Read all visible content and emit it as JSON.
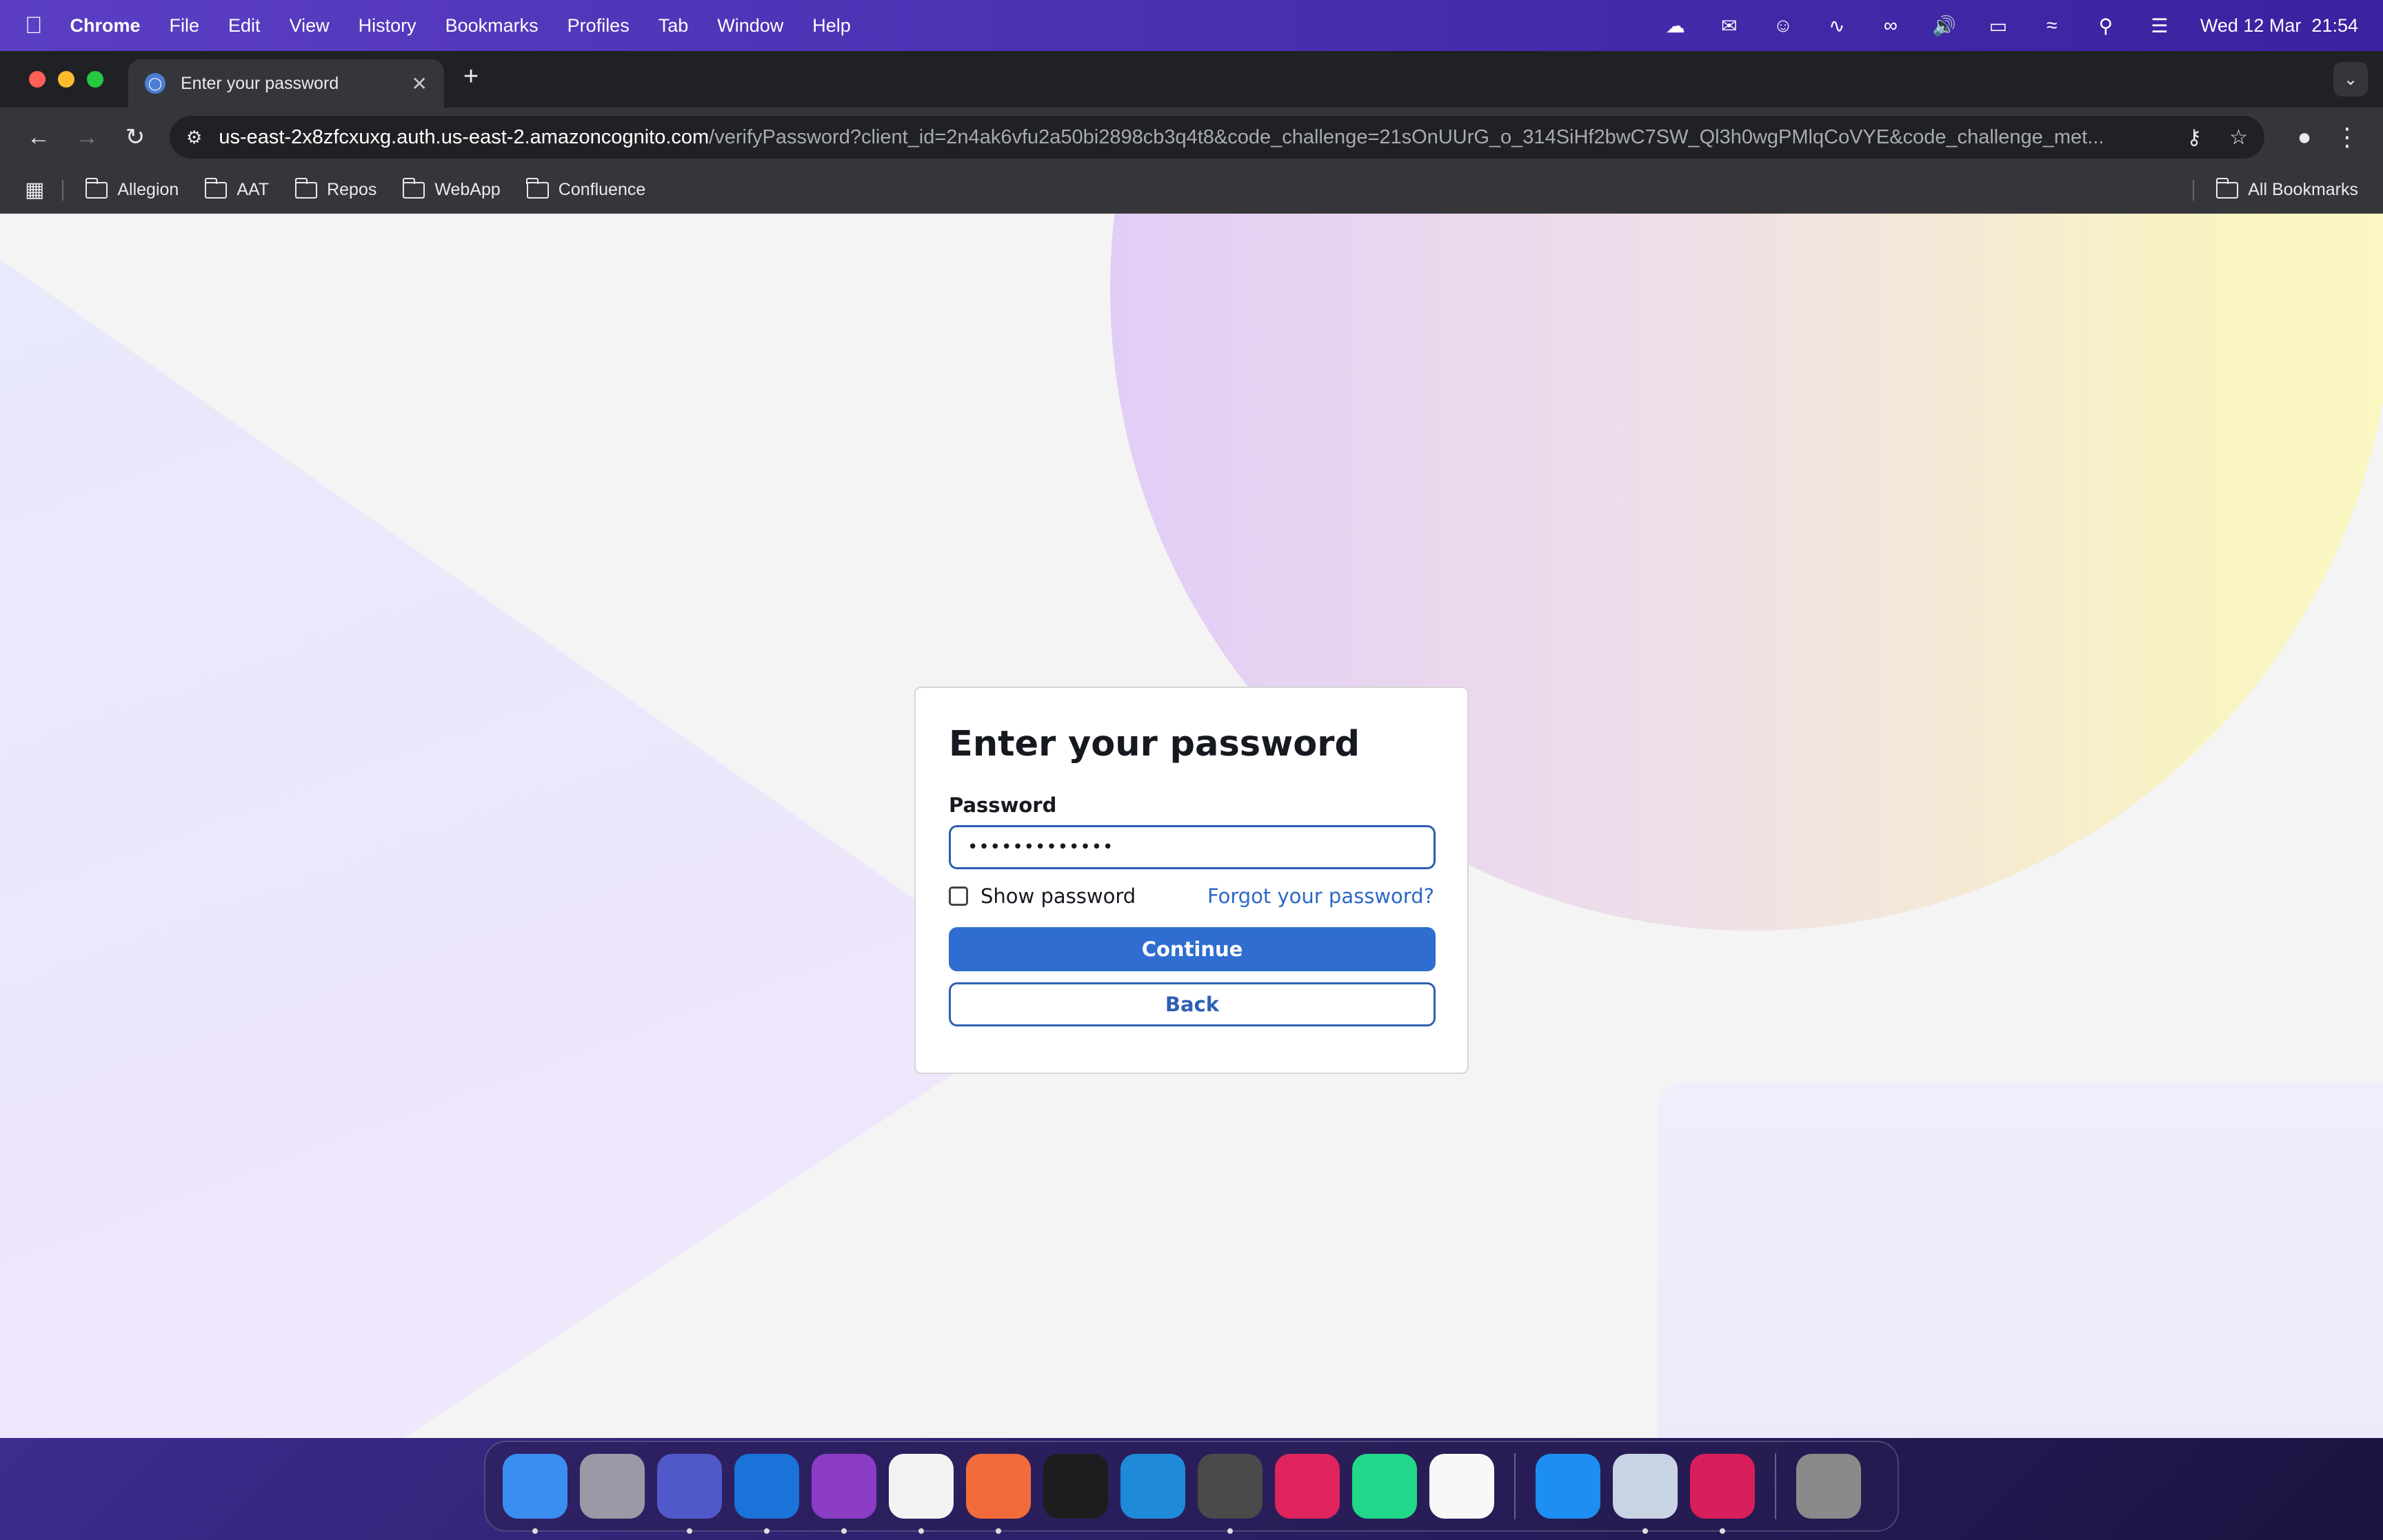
{
  "menubar": {
    "app_name": "Chrome",
    "items": [
      "File",
      "Edit",
      "View",
      "History",
      "Bookmarks",
      "Profiles",
      "Tab",
      "Window",
      "Help"
    ],
    "datetime": "Wed 12 Mar  21:54"
  },
  "browser": {
    "tab_title": "Enter your password",
    "url_host": "us-east-2x8zfcxuxg.auth.us-east-2.amazoncognito.com",
    "url_path": "/verifyPassword?client_id=2n4ak6vfu2a50bi2898cb3q4t8&code_challenge=21sOnUUrG_o_314SiHf2bwC7SW_Ql3h0wgPMlqCoVYE&code_challenge_met...",
    "bookmarks": [
      "Allegion",
      "AAT",
      "Repos",
      "WebApp",
      "Confluence"
    ],
    "all_bookmarks_label": "All Bookmarks"
  },
  "login": {
    "title": "Enter your password",
    "password_label": "Password",
    "password_value": "•••••••••••••",
    "show_password_label": "Show password",
    "forgot_label": "Forgot your password?",
    "continue_label": "Continue",
    "back_label": "Back"
  },
  "dock": {
    "apps": [
      {
        "name": "Finder",
        "color": "#3a8ef0"
      },
      {
        "name": "Launchpad",
        "color": "#9a9aa6"
      },
      {
        "name": "Teams",
        "color": "#5059c9"
      },
      {
        "name": "Outlook",
        "color": "#1a73d8"
      },
      {
        "name": "OneNote",
        "color": "#8a3cc5"
      },
      {
        "name": "Chrome",
        "color": "#f2f2f2"
      },
      {
        "name": "Postman",
        "color": "#f26b3a"
      },
      {
        "name": "Terminal",
        "color": "#1d1d1f"
      },
      {
        "name": "VS Code",
        "color": "#1f8ad8"
      },
      {
        "name": "Sublime",
        "color": "#4a4a4a"
      },
      {
        "name": "IntelliJ",
        "color": "#e0245e"
      },
      {
        "name": "PyCharm",
        "color": "#21d789"
      },
      {
        "name": "Monitor",
        "color": "#f8f8f8"
      },
      {
        "name": "Docker",
        "color": "#1d8ef2"
      },
      {
        "name": "Preview",
        "color": "#c8d4e4"
      },
      {
        "name": "Rider",
        "color": "#d81e5b"
      },
      {
        "name": "Trash",
        "color": "#8a8a8a"
      }
    ]
  }
}
